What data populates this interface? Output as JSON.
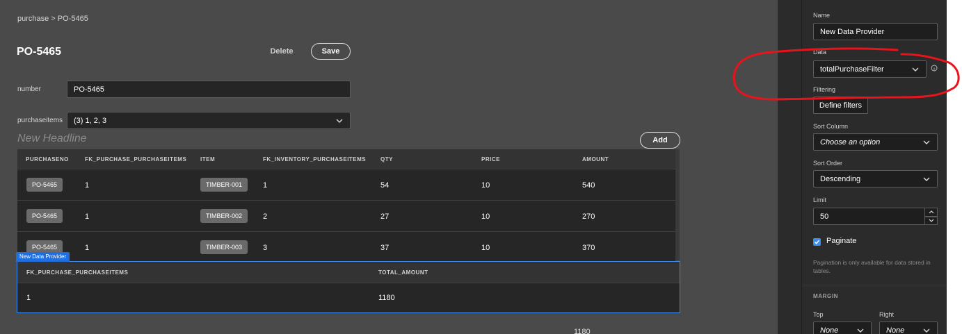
{
  "breadcrumb": "purchase > PO-5465",
  "page_title": "PO-5465",
  "toolbar": {
    "delete_label": "Delete",
    "save_label": "Save"
  },
  "form": {
    "number_label": "number",
    "number_value": "PO-5465",
    "items_label": "purchaseitems",
    "items_value": "(3) 1, 2, 3"
  },
  "headline": "New Headline",
  "add_label": "Add",
  "table": {
    "columns": [
      "PURCHASENO",
      "FK_PURCHASE_PURCHASEITEMS",
      "ITEM",
      "FK_INVENTORY_PURCHASEITEMS",
      "QTY",
      "PRICE",
      "AMOUNT"
    ],
    "rows": [
      [
        "PO-5465",
        "1",
        "TIMBER-001",
        "1",
        "54",
        "10",
        "540"
      ],
      [
        "PO-5465",
        "1",
        "TIMBER-002",
        "2",
        "27",
        "10",
        "270"
      ],
      [
        "PO-5465",
        "1",
        "TIMBER-003",
        "3",
        "37",
        "10",
        "370"
      ]
    ]
  },
  "data_provider": {
    "tag": "New Data Provider",
    "columns": [
      "FK_PURCHASE_PURCHASEITEMS",
      "TOTAL_AMOUNT"
    ],
    "row": [
      "1",
      "1180"
    ]
  },
  "footer_total": "1180",
  "panel": {
    "name_label": "Name",
    "name_value": "New Data Provider",
    "data_label": "Data",
    "data_value": "totalPurchaseFilter",
    "filtering_label": "Filtering",
    "define_filters_label": "Define filters",
    "sort_column_label": "Sort Column",
    "sort_column_value": "Choose an option",
    "sort_order_label": "Sort Order",
    "sort_order_value": "Descending",
    "limit_label": "Limit",
    "limit_value": "50",
    "paginate_label": "Paginate",
    "paginate_checked": true,
    "hint": "Pagination is only available for data stored in tables.",
    "margin_label": "MARGIN",
    "top_label": "Top",
    "top_value": "None",
    "right_label": "Right",
    "right_value": "None"
  },
  "colors": {
    "canvas": "#4a4a4a",
    "panel": "#2b2b2b",
    "accent": "#3f8df0",
    "annotation": "#e8141c"
  },
  "icons": [
    "chevron-down-icon",
    "info-icon",
    "check-icon",
    "chevron-up-icon"
  ]
}
